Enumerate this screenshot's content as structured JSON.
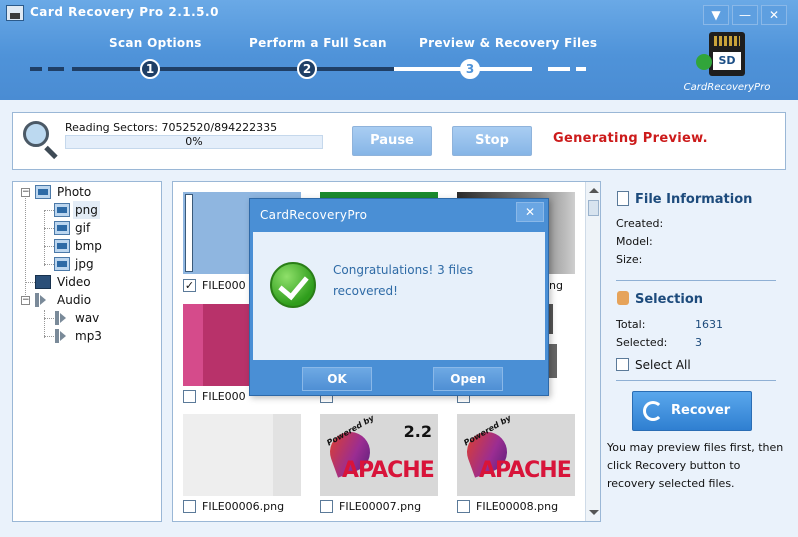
{
  "window": {
    "title": "Card Recovery Pro 2.1.5.0",
    "minimize_glyph": "—",
    "dropdown_glyph": "▼",
    "close_glyph": "✕"
  },
  "steps": [
    {
      "label": "Scan Options",
      "number": "1"
    },
    {
      "label": "Perform a Full Scan",
      "number": "2"
    },
    {
      "label": "Preview & Recovery Files",
      "number": "3"
    }
  ],
  "logo": {
    "card_text": "SD",
    "caption": "CardRecoveryPro"
  },
  "progress": {
    "sectors_text": "Reading Sectors: 7052520/894222335",
    "percent_text": "0%",
    "percent_value": 0,
    "pause_label": "Pause",
    "stop_label": "Stop",
    "status_text": "Generating Preview."
  },
  "tree": {
    "photo": "Photo",
    "png": "png",
    "gif": "gif",
    "bmp": "bmp",
    "jpg": "jpg",
    "video": "Video",
    "audio": "Audio",
    "wav": "wav",
    "mp3": "mp3",
    "collapse_glyph": "−"
  },
  "files": {
    "row1": [
      "FILE000",
      "",
      "ng"
    ],
    "row2": [
      "FILE000",
      "",
      ""
    ],
    "row3": [
      "FILE00006.png",
      "FILE00007.png",
      "FILE00008.png"
    ],
    "row2_suffix": [
      "png",
      "png",
      "png"
    ],
    "checked_glyph": "✓"
  },
  "apache_thumb": {
    "powered": "Powered by",
    "version": "2.2",
    "word": "APACHE"
  },
  "info": {
    "file_info_title": "File Information",
    "created_label": "Created:",
    "model_label": "Model:",
    "size_label": "Size:",
    "selection_title": "Selection",
    "total_label": "Total:",
    "total_value": "1631",
    "selected_label": "Selected:",
    "selected_value": "3",
    "select_all_label": "Select All",
    "recover_label": "Recover",
    "note": "You may preview files first, then click Recovery button to recovery selected files."
  },
  "modal": {
    "title": "CardRecoveryPro",
    "close_glyph": "✕",
    "message": "Congratulations! 3 files recovered!",
    "ok_label": "OK",
    "open_label": "Open"
  },
  "colors": {
    "header_blue": "#4f93d9",
    "status_red": "#cc1b1b",
    "accent_dark_blue": "#1d4b7c"
  }
}
